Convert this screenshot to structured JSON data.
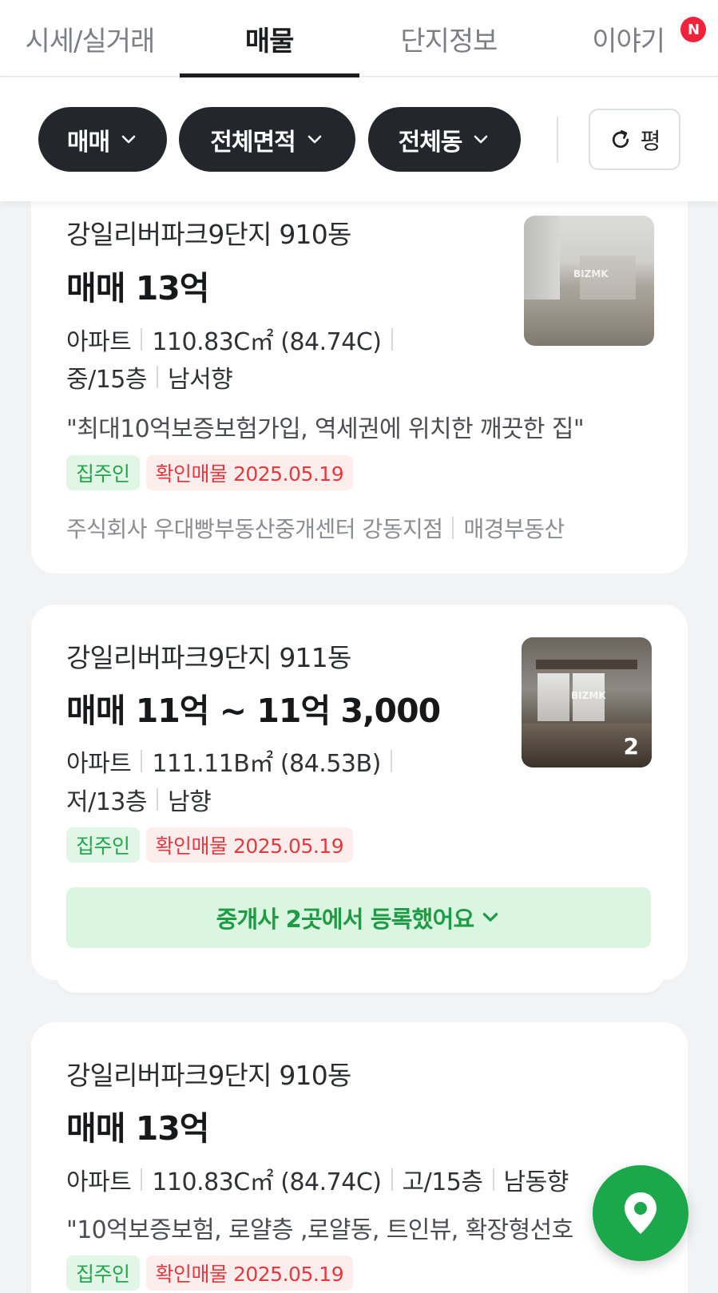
{
  "tabs": [
    {
      "label": "시세/실거래"
    },
    {
      "label": "매물"
    },
    {
      "label": "단지정보"
    },
    {
      "label": "이야기",
      "badge": "N"
    }
  ],
  "filters": {
    "trade_type": "매매",
    "area": "전체면적",
    "building": "전체동",
    "unit_toggle": "평"
  },
  "listings": [
    {
      "name": "강일리버파크9단지 910동",
      "price": "매매 13억",
      "type": "아파트",
      "area": "110.83C㎡ (84.74C)",
      "floor": "중/15층",
      "direction": "남서향",
      "description": "\"최대10억보증보험가입, 역세권에 위치한 깨끗한 집\"",
      "tag_owner": "집주인",
      "tag_verified": "확인매물 2025.05.19",
      "agency": "주식회사 우대빵부동산중개센터 강동지점",
      "source": "매경부동산",
      "watermark": "BIZMK"
    },
    {
      "name": "강일리버파크9단지 911동",
      "price": "매매 11억 ~ 11억 3,000",
      "type": "아파트",
      "area": "111.11B㎡ (84.53B)",
      "floor": "저/13층",
      "direction": "남향",
      "tag_owner": "집주인",
      "tag_verified": "확인매물 2025.05.19",
      "register_text": "중개사 2곳에서 등록했어요",
      "photo_count": "2",
      "watermark": "BIZMK"
    },
    {
      "name": "강일리버파크9단지 910동",
      "price": "매매 13억",
      "type": "아파트",
      "area": "110.83C㎡ (84.74C)",
      "floor": "고/15층",
      "direction": "남동향",
      "description": "\"10억보증보험, 로얄층 ,로얄동, 트인뷰, 확장형선호",
      "tag_owner": "집주인",
      "tag_verified": "확인매물 2025.05.19"
    }
  ],
  "colors": {
    "accent_green": "#1aa84a",
    "chip_dark": "#23262b",
    "verified_red": "#e6393e",
    "badge_red": "#f1233a"
  },
  "icons": {
    "chevron": "chevron-down-icon",
    "refresh": "refresh-icon",
    "map": "map-pin-icon"
  }
}
